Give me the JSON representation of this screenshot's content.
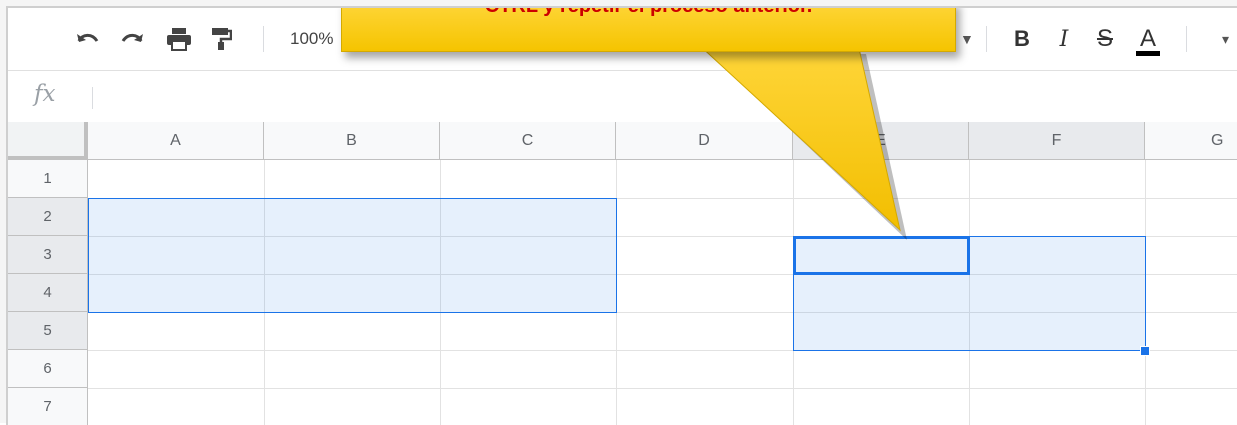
{
  "toolbar": {
    "undo_icon": "undo-icon",
    "redo_icon": "redo-icon",
    "print_icon": "print-icon",
    "paint_format_icon": "paint-format-icon",
    "zoom": "100%",
    "bold": "B",
    "italic": "I",
    "strikethrough": "S",
    "text_color": "A",
    "text_color_value": "#000000"
  },
  "formula_bar": {
    "fx_label": "fx",
    "value": ""
  },
  "columns": [
    "A",
    "B",
    "C",
    "D",
    "E",
    "F",
    "G"
  ],
  "rows": [
    "1",
    "2",
    "3",
    "4",
    "5",
    "6",
    "7"
  ],
  "selection": {
    "range_1": "A2:C4",
    "range_2": "E3:F5",
    "active_cell": "E3",
    "highlight_color": "#1a73e8"
  },
  "callout": {
    "text": "CTRL y repetir el proceso anterior.",
    "fill_color": "#f5c400",
    "text_color": "#cc0000"
  }
}
